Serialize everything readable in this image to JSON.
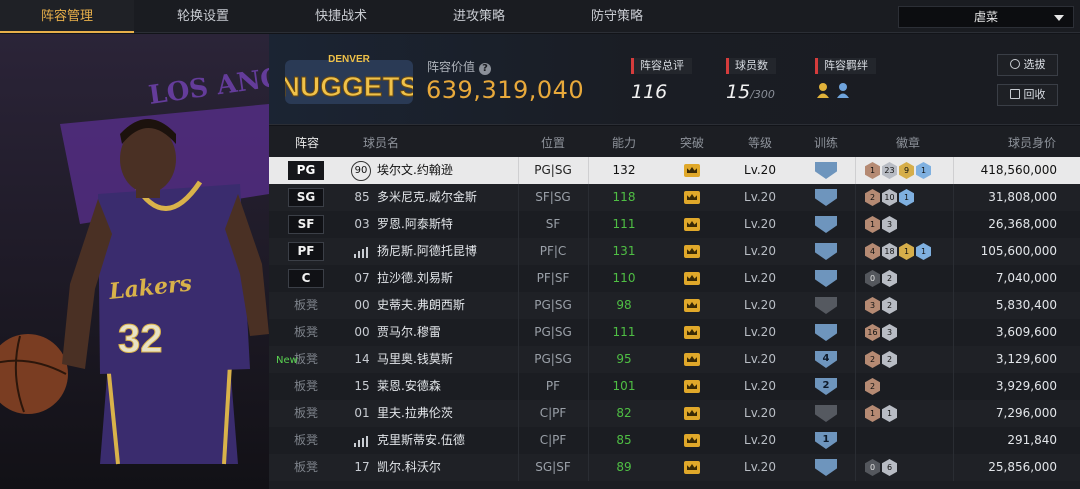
{
  "nav": {
    "tabs": [
      "阵容管理",
      "轮换设置",
      "快捷战术",
      "进攻策略",
      "防守策略"
    ],
    "active": "阵容管理",
    "dropdown_value": "虐菜"
  },
  "header": {
    "team_logo_text": "NUGGETS",
    "team_logo_top": "DENVER",
    "value_label": "阵容价值",
    "value": "639,319,040",
    "stats": [
      {
        "title": "阵容总评",
        "value": "116",
        "suffix": ""
      },
      {
        "title": "球员数",
        "value": "15",
        "suffix": "/300"
      },
      {
        "title": "阵容羁绊",
        "value": "",
        "suffix": ""
      }
    ],
    "buttons": {
      "select": "选拔",
      "recycle": "回收"
    }
  },
  "left_art": {
    "backdrop_text": "LOS ANGELES LAKERS",
    "jersey_text": "Lakers",
    "jersey_number": "32"
  },
  "table": {
    "headers": [
      "阵容",
      "球员名",
      "位置",
      "能力",
      "突破",
      "等级",
      "训练",
      "徽章",
      "球员身价"
    ],
    "rows": [
      {
        "slot": "PG",
        "starter": true,
        "num": "90",
        "num_type": "circle",
        "name": "埃尔文.约翰逊",
        "pos": "PG|SG",
        "ability": "132",
        "level": "Lv.20",
        "train": "",
        "train_grey": false,
        "badges": [
          [
            "bronze",
            "1"
          ],
          [
            "silver",
            "23"
          ],
          [
            "gold",
            "9"
          ],
          [
            "blue",
            "1"
          ]
        ],
        "price": "418,560,000"
      },
      {
        "slot": "SG",
        "starter": true,
        "num": "85",
        "num_type": "text",
        "name": "多米尼克.威尔金斯",
        "pos": "SF|SG",
        "ability": "118",
        "level": "Lv.20",
        "train": "",
        "train_grey": false,
        "badges": [
          [
            "bronze",
            "2"
          ],
          [
            "silver",
            "10"
          ],
          [
            "blue",
            "1"
          ]
        ],
        "price": "31,808,000"
      },
      {
        "slot": "SF",
        "starter": true,
        "num": "03",
        "num_type": "text",
        "name": "罗恩.阿泰斯特",
        "pos": "SF",
        "ability": "111",
        "level": "Lv.20",
        "train": "",
        "train_grey": false,
        "badges": [
          [
            "bronze",
            "1"
          ],
          [
            "silver",
            "3"
          ]
        ],
        "price": "26,368,000"
      },
      {
        "slot": "PF",
        "starter": true,
        "num": "",
        "num_type": "bars",
        "name": "扬尼斯.阿德托昆博",
        "pos": "PF|C",
        "ability": "131",
        "level": "Lv.20",
        "train": "",
        "train_grey": false,
        "badges": [
          [
            "bronze",
            "4"
          ],
          [
            "silver",
            "18"
          ],
          [
            "gold",
            "1"
          ],
          [
            "blue",
            "1"
          ]
        ],
        "price": "105,600,000"
      },
      {
        "slot": "C",
        "starter": true,
        "num": "07",
        "num_type": "text",
        "name": "拉沙德.刘易斯",
        "pos": "PF|SF",
        "ability": "110",
        "level": "Lv.20",
        "train": "",
        "train_grey": false,
        "badges": [
          [
            "dark",
            "0"
          ],
          [
            "silver",
            "2"
          ]
        ],
        "price": "7,040,000"
      },
      {
        "slot": "板凳",
        "starter": false,
        "num": "00",
        "num_type": "text",
        "name": "史蒂夫.弗朗西斯",
        "pos": "PG|SG",
        "ability": "98",
        "level": "Lv.20",
        "train": "",
        "train_grey": true,
        "badges": [
          [
            "bronze",
            "3"
          ],
          [
            "silver",
            "2"
          ]
        ],
        "price": "5,830,400"
      },
      {
        "slot": "板凳",
        "starter": false,
        "num": "00",
        "num_type": "text",
        "name": "贾马尔.穆雷",
        "pos": "PG|SG",
        "ability": "111",
        "level": "Lv.20",
        "train": "",
        "train_grey": false,
        "badges": [
          [
            "bronze",
            "16"
          ],
          [
            "silver",
            "3"
          ]
        ],
        "price": "3,609,600"
      },
      {
        "slot": "板凳",
        "starter": false,
        "num": "14",
        "num_type": "text",
        "name": "马里奥.钱莫斯",
        "pos": "PG|SG",
        "ability": "95",
        "level": "Lv.20",
        "train": "4",
        "train_grey": false,
        "badges": [
          [
            "bronze",
            "2"
          ],
          [
            "silver",
            "2"
          ]
        ],
        "price": "3,129,600"
      },
      {
        "slot": "板凳",
        "starter": false,
        "num": "15",
        "num_type": "text",
        "name": "莱恩.安德森",
        "pos": "PF",
        "ability": "101",
        "level": "Lv.20",
        "train": "2",
        "train_grey": false,
        "badges": [
          [
            "bronze",
            "2"
          ]
        ],
        "price": "3,929,600"
      },
      {
        "slot": "板凳",
        "starter": false,
        "num": "01",
        "num_type": "text",
        "name": "里夫.拉弗伦茨",
        "pos": "C|PF",
        "ability": "82",
        "level": "Lv.20",
        "train": "",
        "train_grey": true,
        "badges": [
          [
            "bronze",
            "1"
          ],
          [
            "silver",
            "1"
          ]
        ],
        "price": "7,296,000"
      },
      {
        "slot": "板凳",
        "starter": false,
        "num": "",
        "num_type": "bars",
        "name": "克里斯蒂安.伍德",
        "pos": "C|PF",
        "ability": "85",
        "level": "Lv.20",
        "train": "1",
        "train_grey": false,
        "badges": [],
        "price": "291,840"
      },
      {
        "slot": "板凳",
        "starter": false,
        "num": "17",
        "num_type": "text",
        "name": "凯尔.科沃尔",
        "pos": "SG|SF",
        "ability": "89",
        "level": "Lv.20",
        "train": "",
        "train_grey": false,
        "badges": [
          [
            "dark",
            "0"
          ],
          [
            "silver",
            "6"
          ]
        ],
        "price": "25,856,000"
      }
    ],
    "new_tag": "New"
  }
}
